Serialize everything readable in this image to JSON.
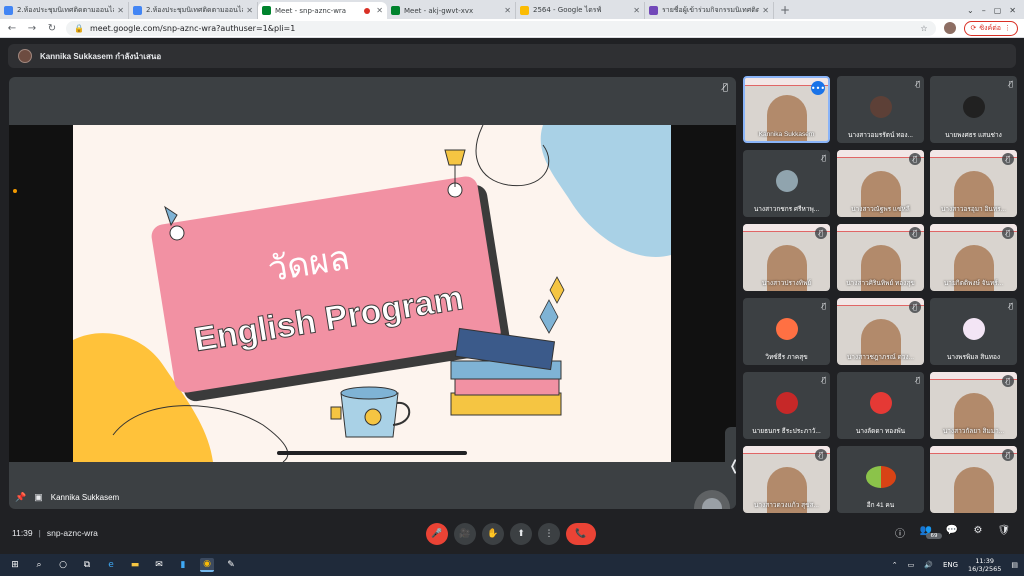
{
  "browser": {
    "tabs": [
      {
        "title": "2.ห้องประชุมนิเทศติดตามออนไลน์ ภาคเรี",
        "favicon_color": "#4285f4",
        "active": false,
        "recording": false
      },
      {
        "title": "2.ห้องประชุมนิเทศติดตามออนไลน์ ภาคเรี",
        "favicon_color": "#4285f4",
        "active": false,
        "recording": false
      },
      {
        "title": "Meet - snp-aznc-wra",
        "favicon_color": "#00832d",
        "active": true,
        "recording": true
      },
      {
        "title": "Meet - akj-gwvt-xvx",
        "favicon_color": "#00832d",
        "active": false,
        "recording": false
      },
      {
        "title": "2564 - Google ไดรฟ์",
        "favicon_color": "#fbbc04",
        "active": false,
        "recording": false
      },
      {
        "title": "รายชื่อผู้เข้าร่วมกิจกรรมนิเทศติดตามออ",
        "favicon_color": "#7248b9",
        "active": false,
        "recording": false
      }
    ],
    "new_tab": "+",
    "url": "meet.google.com/snp-aznc-wra?authuser=1&pli=1",
    "sync_label": "ซิงค์ต่อ",
    "back": "←",
    "forward": "→",
    "reload": "↻"
  },
  "meet": {
    "presenting_banner": "Kannika Sukkasem กำลังนำเสนอ",
    "stage_label": "Kannika Sukkasem",
    "meeting_time": "11:39",
    "meeting_code": "snp-aznc-wra",
    "participants_count": "69",
    "others_label": "อีก 41 คน"
  },
  "slide": {
    "thai_title": "วัดผล",
    "english_title": "English Program"
  },
  "participants": [
    {
      "name": "Kannika Sukkasem",
      "type": "self"
    },
    {
      "name": "นางสาวอมรรัตน์ ทอง...",
      "type": "avatar",
      "color": "#5d4037"
    },
    {
      "name": "นายพงศธร แสนช่าง",
      "type": "avatar",
      "color": "#212121"
    },
    {
      "name": "นางสาวกชกร ศรีหาพุ...",
      "type": "avatar",
      "color": "#90a4ae"
    },
    {
      "name": "นางสาวณัฐพร แซ่หลี",
      "type": "video"
    },
    {
      "name": "นางสาวอรอุมา อินทร...",
      "type": "video"
    },
    {
      "name": "นางสาวปรางทิพย์",
      "type": "video"
    },
    {
      "name": "นางสาวศิรินทิพย์ ทองสุข",
      "type": "video"
    },
    {
      "name": "นายกิตติพงษ์ จันทร์...",
      "type": "video"
    },
    {
      "name": "วิทซ์ธีร ภาคสุข",
      "type": "avatar",
      "color": "#ff7043"
    },
    {
      "name": "นางสาวชฎาภรณ์ ดวง...",
      "type": "video"
    },
    {
      "name": "นางพรพิมล สินทอง",
      "type": "avatar",
      "color": "#f3e5f5"
    },
    {
      "name": "นายธนกร ธีระประภาวั...",
      "type": "avatar",
      "color": "#c62828"
    },
    {
      "name": "นางลัดดา ทองพัน",
      "type": "avatar",
      "color": "#e53935"
    },
    {
      "name": "นางสาวกัลยา สิมมา...",
      "type": "video"
    },
    {
      "name": "นางสาวดวงแก้ว สุขส...",
      "type": "video"
    },
    {
      "name": "อีก 41 คน",
      "type": "others"
    },
    {
      "name": "",
      "type": "video"
    }
  ],
  "controls": {
    "mic": "🎤",
    "camera": "🎥",
    "hand": "✋",
    "present": "⬆",
    "more": "⋮",
    "end": "📞",
    "info": "ⓘ",
    "people": "👥",
    "chat": "💬",
    "activities": "⚙",
    "host": "🛡"
  },
  "taskbar": {
    "language": "ENG",
    "time": "11:39",
    "date": "16/3/2565"
  },
  "colors": {
    "accent": "#1a73e8",
    "danger": "#ea4335",
    "slide_pink": "#f291a3"
  }
}
